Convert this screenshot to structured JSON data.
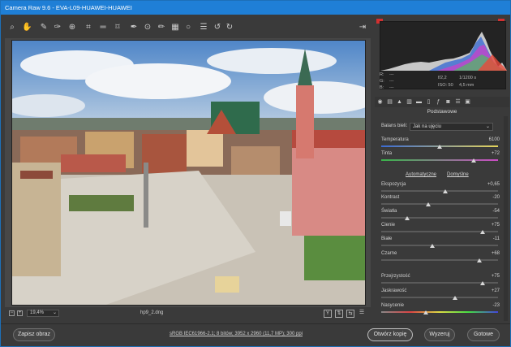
{
  "window": {
    "title": "Camera Raw 9.6  -  EVA-L09-HUAWEI-HUAWEI"
  },
  "toolbar": {
    "tools": [
      "zoom-icon",
      "hand-icon",
      "white-balance-icon",
      "color-sampler-icon",
      "target-adjust-icon",
      "crop-icon",
      "straighten-icon",
      "transform-icon",
      "spot-removal-icon",
      "red-eye-icon",
      "adjustment-brush-icon",
      "graduated-filter-icon",
      "radial-filter-icon",
      "list-icon",
      "rotate-left-icon",
      "rotate-right-icon"
    ]
  },
  "status": {
    "zoom": "19,4%",
    "filename": "hp9_2.dng"
  },
  "histogram": {
    "r": "R:",
    "g": "G:",
    "b": "B:",
    "dash": "---",
    "aperture": "f/2,2",
    "shutter": "1/1200 s",
    "iso": "ISO: 50",
    "focal": "4,5 mm"
  },
  "panel": {
    "section": "Podstawowe",
    "wb_label": "Balans bieli:",
    "wb_value": "Jak na ujęciu",
    "auto": "Automatyczne",
    "default": "Domyślne",
    "rows": [
      {
        "label": "Temperatura",
        "value": "6100",
        "pos": 0.5
      },
      {
        "label": "Tinta",
        "value": "+72",
        "pos": 0.79
      },
      {
        "label": "Ekspozycja",
        "value": "+0,65",
        "pos": 0.55
      },
      {
        "label": "Kontrast",
        "value": "-20",
        "pos": 0.4
      },
      {
        "label": "Światła",
        "value": "-54",
        "pos": 0.22
      },
      {
        "label": "Cienie",
        "value": "+75",
        "pos": 0.87
      },
      {
        "label": "Białe",
        "value": "-11",
        "pos": 0.44
      },
      {
        "label": "Czarne",
        "value": "+68",
        "pos": 0.84
      },
      {
        "label": "Przejrzystość",
        "value": "+75",
        "pos": 0.87
      },
      {
        "label": "Jaskrawość",
        "value": "+27",
        "pos": 0.63
      },
      {
        "label": "Nasycenie",
        "value": "-23",
        "pos": 0.38
      }
    ]
  },
  "bottom": {
    "save": "Zapisz obraz",
    "info": "sRGB IEC61966-2.1; 8 bitów; 3952 x 2960 (11,7 MP); 300 ppi",
    "open": "Otwórz kopię",
    "reset": "Wyzeruj",
    "done": "Gotowe"
  }
}
